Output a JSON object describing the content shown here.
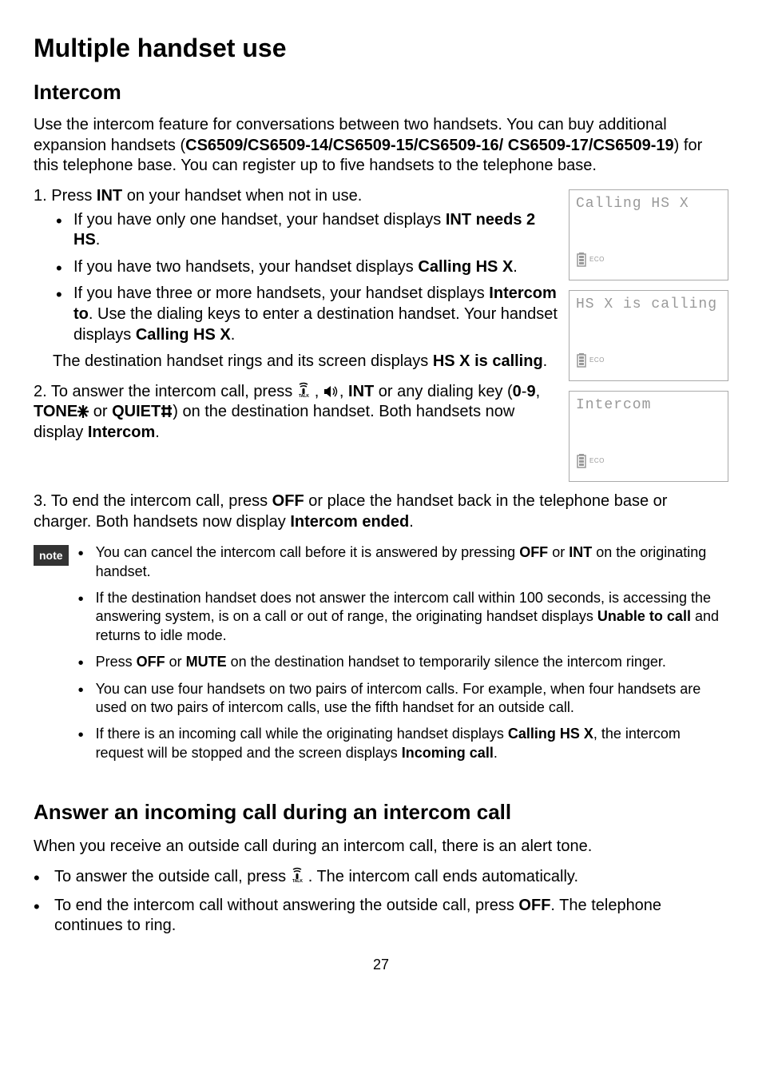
{
  "section_title": "Multiple handset use",
  "intercom": {
    "heading": "Intercom",
    "intro_pre": "Use the intercom feature for conversations between two handsets. You can buy additional expansion handsets (",
    "models": "CS6509/CS6509-14/CS6509-15/CS6509-16/ CS6509-17/CS6509-19",
    "intro_post": ") for this telephone base. You can register up to five handsets to the telephone base.",
    "step1_pre": "1. Press ",
    "step1_key": "INT",
    "step1_post": " on your handset when not in use.",
    "b1_pre": "If you have only one handset, your handset displays ",
    "b1_bold": "INT needs 2 HS",
    "b1_post": ".",
    "b2_pre": "If you have two handsets, your handset displays ",
    "b2_bold": "Calling HS X",
    "b2_post": ".",
    "b3_pre": "If you have three or more handsets, your handset displays ",
    "b3_bold": "Intercom to",
    "b3_mid": ". Use the dialing keys to enter a destination handset. Your handset displays ",
    "b3_bold2": "Calling HS X",
    "b3_post": ".",
    "dest_pre": "The destination handset rings and its screen displays ",
    "dest_bold": "HS X is calling",
    "dest_post": ".",
    "step2_pre": "2. To answer the intercom call, press ",
    "step2_mid1": ", ",
    "step2_mid2": ", ",
    "step2_int": "INT",
    "step2_mid3": " or any dialing key (",
    "step2_09": "0",
    "step2_dash": "-",
    "step2_9": "9",
    "step2_c1": ", ",
    "step2_tone": "TONE",
    "step2_or": " or ",
    "step2_quiet": "QUIET",
    "step2_post": ") on the destination handset. Both handsets now display ",
    "step2_bold": "Intercom",
    "step2_end": ".",
    "step3_pre": "3. To end the intercom call, press ",
    "step3_off": "OFF",
    "step3_mid": " or place the handset back in the telephone base or charger. Both handsets now display ",
    "step3_bold": "Intercom ended",
    "step3_end": "."
  },
  "screens": {
    "s1": "Calling HS X",
    "s2": "HS X is calling",
    "s3": "Intercom",
    "eco": "ECO"
  },
  "note": {
    "label": "note",
    "n1_pre": "You can cancel the intercom call before it is answered by pressing ",
    "n1_off": "OFF",
    "n1_or": " or ",
    "n1_int": "INT",
    "n1_post": " on the originating handset.",
    "n2_pre": "If the destination handset does not answer the intercom call within 100 seconds, is accessing the answering system, is on a call or out of range, the originating handset displays ",
    "n2_bold": "Unable to call",
    "n2_post": " and returns to idle mode.",
    "n3_pre": "Press ",
    "n3_off": "OFF",
    "n3_or": " or ",
    "n3_mute": "MUTE",
    "n3_post": " on the destination handset to temporarily silence the intercom ringer.",
    "n4": "You can use four handsets on two pairs of intercom calls. For example, when four handsets are used on two pairs of intercom calls, use the fifth handset for an outside call.",
    "n5_pre": "If there is an incoming call while the originating handset displays ",
    "n5_b1": "Calling HS X",
    "n5_mid": ", the intercom request will be stopped and the screen displays ",
    "n5_b2": "Incoming call",
    "n5_post": "."
  },
  "answer": {
    "heading": "Answer an incoming call during an intercom call",
    "intro": "When you receive an outside call during an intercom call, there is an alert tone.",
    "b1_pre": "To answer the outside call, press ",
    "b1_post": ". The intercom call ends automatically.",
    "b2_pre": "To end the intercom call without answering the outside call, press ",
    "b2_off": "OFF",
    "b2_post": ". The telephone continues to ring."
  },
  "page_number": "27"
}
